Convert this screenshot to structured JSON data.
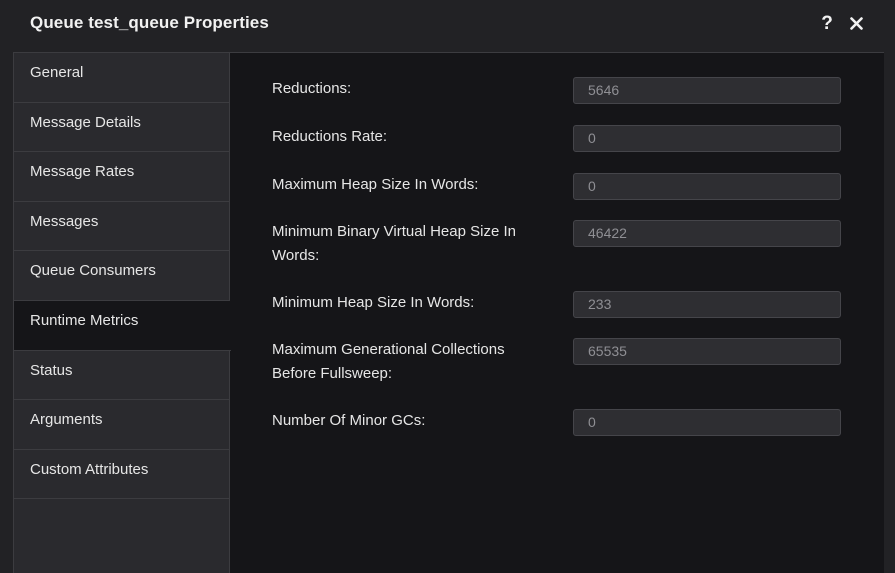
{
  "window": {
    "title": "Queue test_queue Properties",
    "help_label": "?",
    "close_label": "×"
  },
  "sidebar": {
    "items": [
      {
        "label": "General"
      },
      {
        "label": "Message Details"
      },
      {
        "label": "Message Rates"
      },
      {
        "label": "Messages"
      },
      {
        "label": "Queue Consumers"
      },
      {
        "label": "Runtime Metrics",
        "active": true
      },
      {
        "label": "Status"
      },
      {
        "label": "Arguments"
      },
      {
        "label": "Custom Attributes"
      }
    ]
  },
  "metrics": [
    {
      "label": "Reductions:",
      "value": "5646"
    },
    {
      "label": "Reductions Rate:",
      "value": "0"
    },
    {
      "label": "Maximum Heap Size In Words:",
      "value": "0"
    },
    {
      "label": "Minimum Binary Virtual Heap Size In Words:",
      "value": "46422"
    },
    {
      "label": "Minimum Heap Size In Words:",
      "value": "233"
    },
    {
      "label": "Maximum Generational Collections Before Fullsweep:",
      "value": "65535"
    },
    {
      "label": "Number Of Minor GCs:",
      "value": "0"
    }
  ]
}
